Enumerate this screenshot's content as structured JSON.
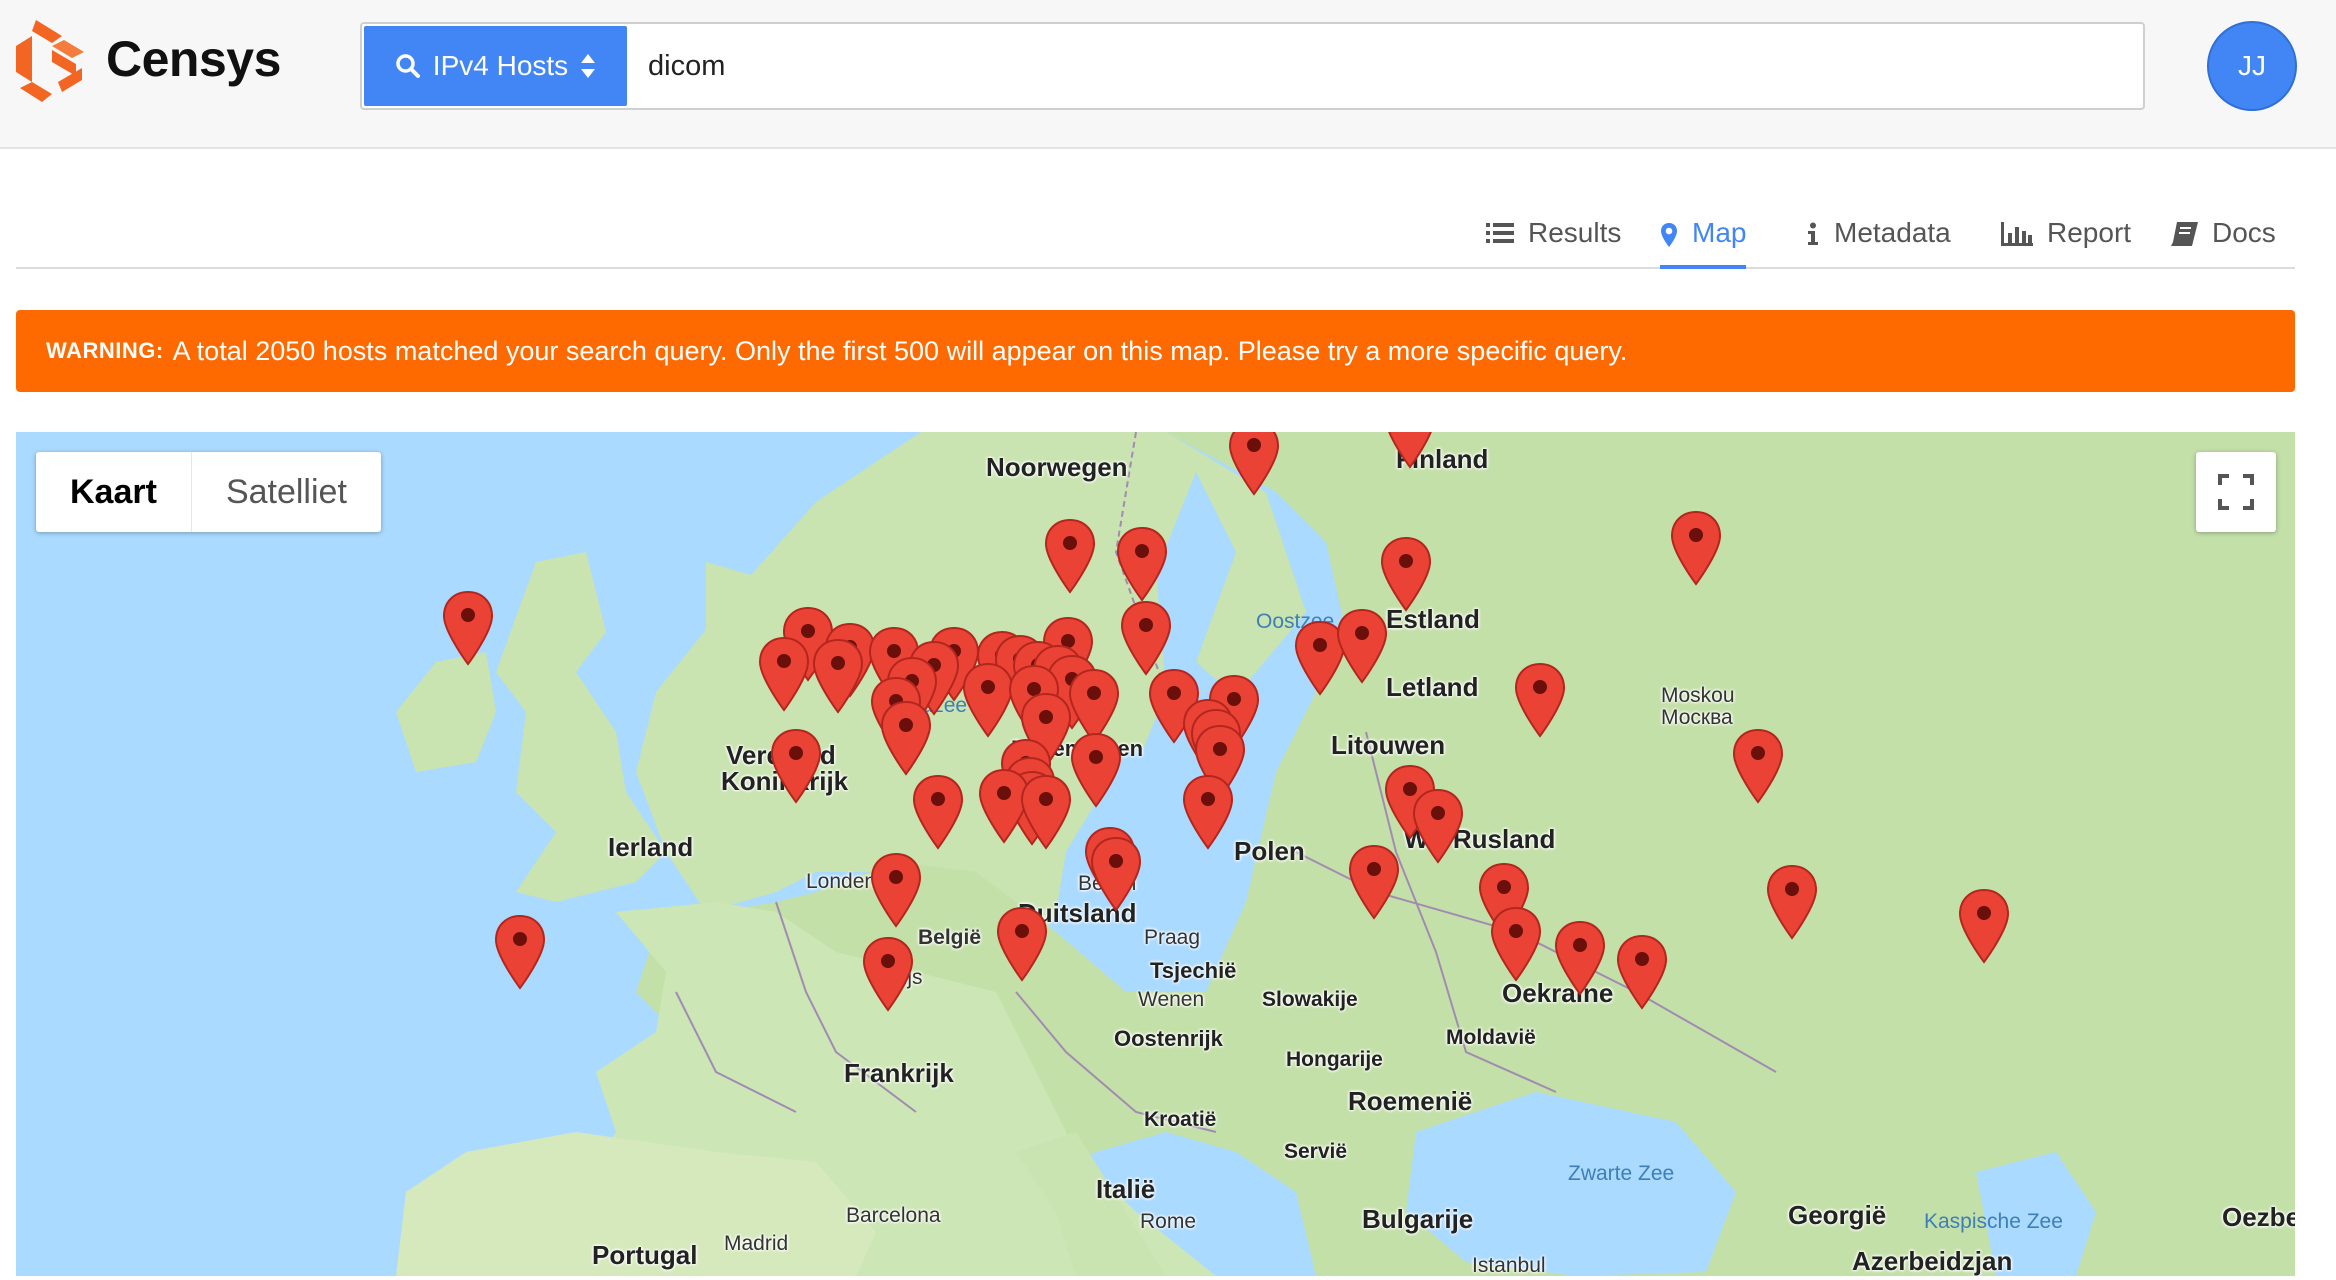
{
  "brand": {
    "name": "Censys"
  },
  "search": {
    "type_label": "IPv4 Hosts",
    "query": "dicom"
  },
  "user": {
    "initials": "JJ"
  },
  "tabs": [
    {
      "label": "Results",
      "icon": "list-icon",
      "active": false
    },
    {
      "label": "Map",
      "icon": "map-marker-icon",
      "active": true
    },
    {
      "label": "Metadata",
      "icon": "info-icon",
      "active": false
    },
    {
      "label": "Report",
      "icon": "bar-chart-icon",
      "active": false
    },
    {
      "label": "Docs",
      "icon": "book-icon",
      "active": false
    }
  ],
  "warning": {
    "prefix": "WARNING:",
    "text": "A total 2050 hosts matched your search query. Only the first 500 will appear on this map. Please try a more specific query."
  },
  "map": {
    "type_control": {
      "map": "Kaart",
      "satellite": "Satelliet"
    },
    "labels": {
      "noorwegen": "Noorwegen",
      "finland": "Finland",
      "oostzee": "Oostzee",
      "estland": "Estland",
      "noordzee": "Noordzee",
      "letland": "Letland",
      "moskou": "Moskou",
      "moskva": "Москва",
      "denemarken": "Denemarken",
      "verenigd": "Verenigd",
      "koninkrijk": "Koninkrijk",
      "litouwen": "Litouwen",
      "ierland": "Ierland",
      "polen": "Polen",
      "wit_rusland": "Wit-Rusland",
      "londen": "Londen",
      "berlijn": "Berlijn",
      "belgie": "België",
      "duitsland": "Duitsland",
      "praag": "Praag",
      "parijs": "Parijs",
      "tsjechie": "Tsjechië",
      "wenen": "Wenen",
      "slowakije": "Slowakije",
      "oekraine": "Oekraïne",
      "moldavie": "Moldavië",
      "oostenrijk": "Oostenrijk",
      "frankrijk": "Frankrijk",
      "hongarije": "Hongarije",
      "roemenie": "Roemenië",
      "kroatie": "Kroatië",
      "servie": "Servië",
      "zwarte_zee": "Zwarte Zee",
      "italie": "Italië",
      "georgie": "Georgië",
      "kaspische_zee": "Kaspische Zee",
      "oezbe": "Oezbe",
      "barcelona": "Barcelona",
      "rome": "Rome",
      "portugal": "Portugal",
      "madrid": "Madrid",
      "bulgarije": "Bulgarije",
      "istanbul": "Istanbul",
      "azerbeidzjan": "Azerbeidzjan"
    }
  },
  "colors": {
    "brand_orange": "#f26522",
    "accent_blue": "#4285f4",
    "warning_orange": "#ff6a00",
    "marker_red": "#ea4335",
    "water": "#aadaff",
    "land": "#c8e2b0"
  }
}
